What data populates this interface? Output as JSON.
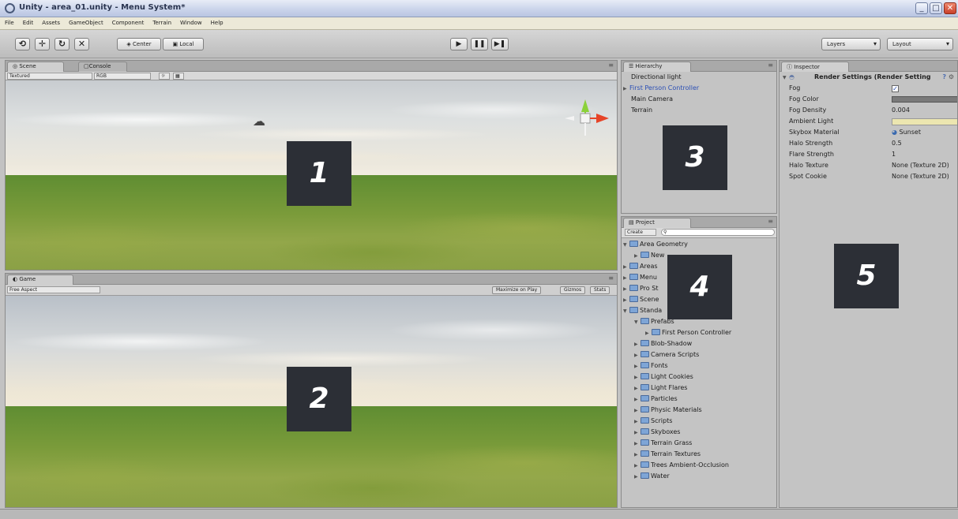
{
  "window": {
    "title": "Unity - area_01.unity - Menu System*",
    "minimize_icon": "minimize-icon",
    "maximize_icon": "maximize-icon",
    "close_icon": "close-icon",
    "close_color": "#d04a30"
  },
  "menubar": {
    "items": [
      "File",
      "Edit",
      "Assets",
      "GameObject",
      "Component",
      "Terrain",
      "Window",
      "Help"
    ]
  },
  "toolbar": {
    "tools": [
      "hand-icon",
      "move-icon",
      "rotate-icon",
      "scale-icon"
    ],
    "pivot_label": "Center",
    "space_label": "Local",
    "play_icon": "play-icon",
    "pause_icon": "pause-icon",
    "step_icon": "step-icon",
    "layers_label": "Layers",
    "layout_label": "Layout"
  },
  "scene_panel": {
    "tabs": [
      "Scene",
      "Console"
    ],
    "render_mode": "Textured",
    "color_mode": "RGB",
    "callout": "1"
  },
  "game_panel": {
    "tab": "Game",
    "aspect": "Free Aspect",
    "toggles": [
      "Maximize on Play",
      "Gizmos",
      "Stats"
    ],
    "callout": "2"
  },
  "hierarchy_panel": {
    "tab": "Hierarchy",
    "items": [
      {
        "label": "Directional light",
        "selected": false,
        "expandable": false
      },
      {
        "label": "First Person Controller",
        "selected": true,
        "expandable": true
      },
      {
        "label": "Main Camera",
        "selected": false,
        "expandable": false
      },
      {
        "label": "Terrain",
        "selected": false,
        "expandable": false
      }
    ],
    "selected_color": "#2b4fb5",
    "callout": "3"
  },
  "project_panel": {
    "tab": "Project",
    "create_label": "Create",
    "items": [
      {
        "label": "Area Geometry",
        "depth": 0,
        "expanded": true
      },
      {
        "label": "New",
        "depth": 1,
        "expanded": false
      },
      {
        "label": "Areas",
        "depth": 0,
        "expanded": false
      },
      {
        "label": "Menu",
        "depth": 0,
        "expanded": false
      },
      {
        "label": "Pro St",
        "depth": 0,
        "expanded": false
      },
      {
        "label": "Scene",
        "depth": 0,
        "expanded": false
      },
      {
        "label": "Standa",
        "depth": 0,
        "expanded": true
      },
      {
        "label": "Prefabs",
        "depth": 1,
        "expanded": true
      },
      {
        "label": "First Person Controller",
        "depth": 2,
        "expanded": false
      },
      {
        "label": "Blob-Shadow",
        "depth": 1,
        "expanded": false
      },
      {
        "label": "Camera Scripts",
        "depth": 1,
        "expanded": false
      },
      {
        "label": "Fonts",
        "depth": 1,
        "expanded": false
      },
      {
        "label": "Light Cookies",
        "depth": 1,
        "expanded": false
      },
      {
        "label": "Light Flares",
        "depth": 1,
        "expanded": false
      },
      {
        "label": "Particles",
        "depth": 1,
        "expanded": false
      },
      {
        "label": "Physic Materials",
        "depth": 1,
        "expanded": false
      },
      {
        "label": "Scripts",
        "depth": 1,
        "expanded": false
      },
      {
        "label": "Skyboxes",
        "depth": 1,
        "expanded": false
      },
      {
        "label": "Terrain Grass",
        "depth": 1,
        "expanded": false
      },
      {
        "label": "Terrain Textures",
        "depth": 1,
        "expanded": false
      },
      {
        "label": "Trees Ambient-Occlusion",
        "depth": 1,
        "expanded": false
      },
      {
        "label": "Water",
        "depth": 1,
        "expanded": false
      }
    ],
    "callout": "4"
  },
  "inspector_panel": {
    "tab": "Inspector",
    "header": "Render Settings (Render Setting",
    "rows": [
      {
        "label": "Fog",
        "value": ""
      },
      {
        "label": "Fog Color",
        "value": ""
      },
      {
        "label": "Fog Density",
        "value": "0.004"
      },
      {
        "label": "Ambient Light",
        "value": ""
      },
      {
        "label": "Skybox Material",
        "value": "Sunset"
      },
      {
        "label": "Halo Strength",
        "value": "0.5"
      },
      {
        "label": "Flare Strength",
        "value": "1"
      },
      {
        "label": "Halo Texture",
        "value": "None (Texture 2D)"
      },
      {
        "label": "Spot Cookie",
        "value": "None (Texture 2D)"
      }
    ],
    "fog_enabled": true,
    "fog_color": "#7a7a7a",
    "ambient_color": "#ece6b0",
    "callout": "5"
  }
}
